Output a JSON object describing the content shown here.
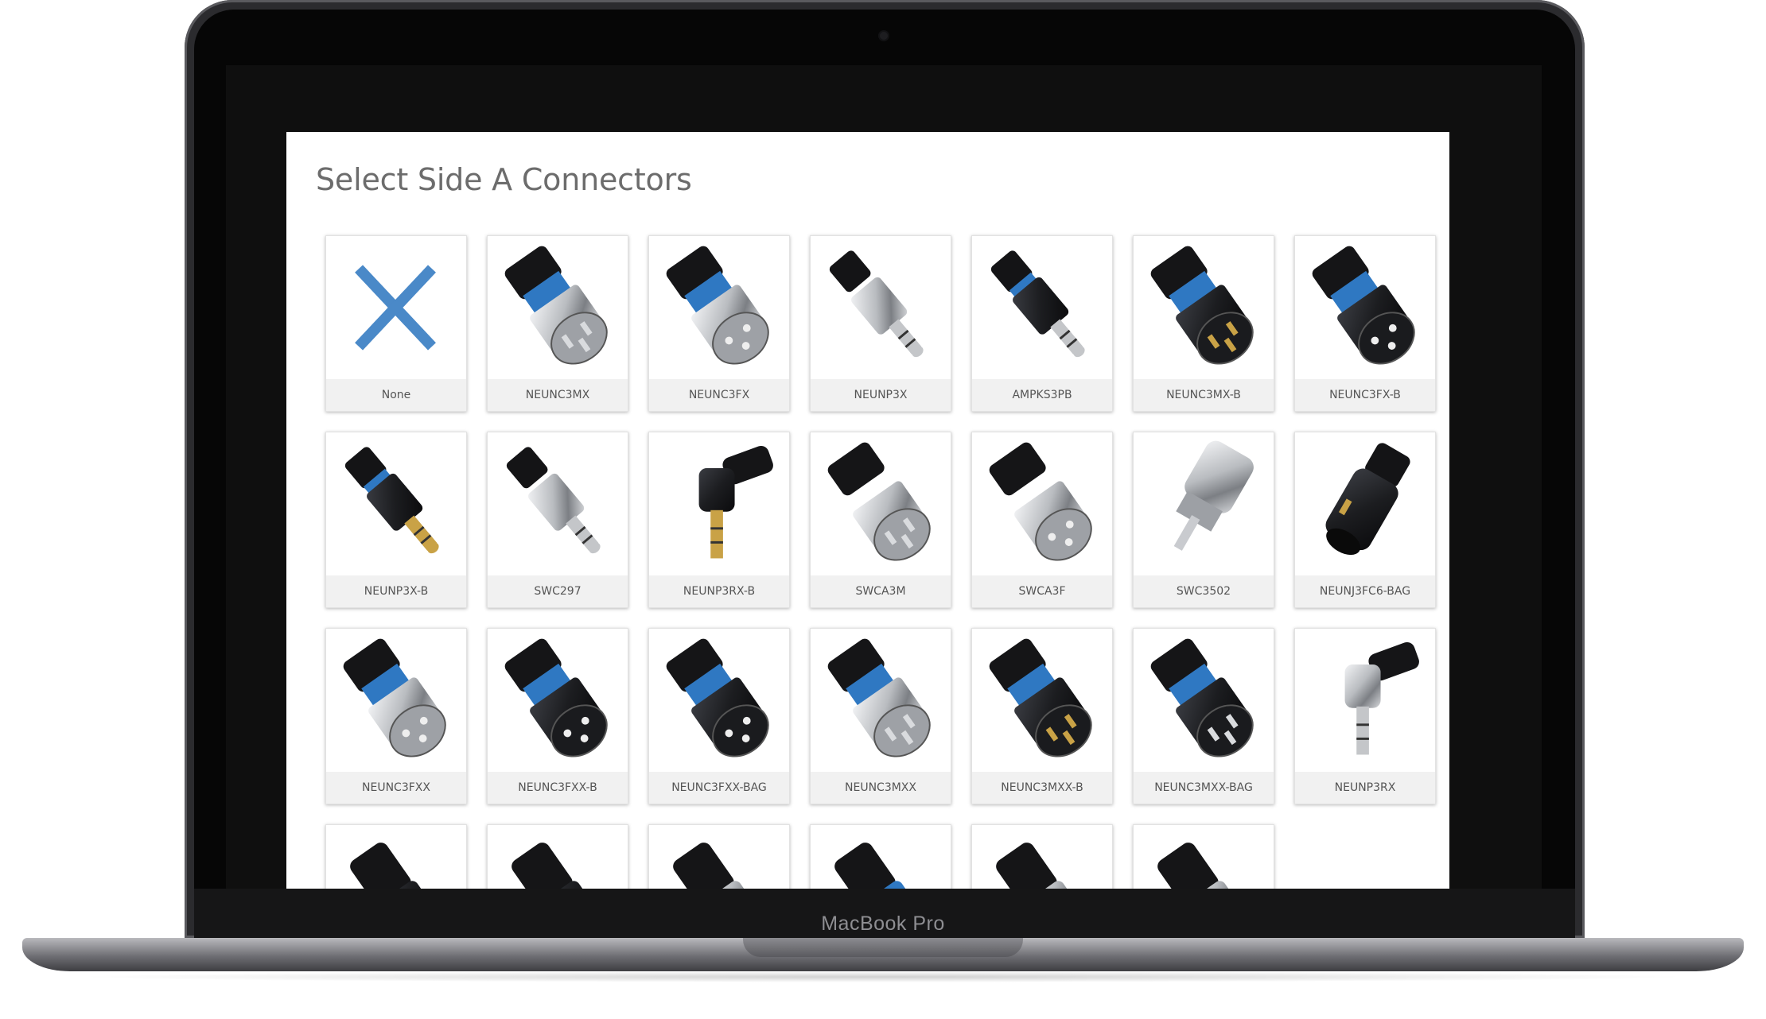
{
  "device": {
    "brand": "MacBook Pro"
  },
  "page": {
    "title": "Select Side A Connectors"
  },
  "connectors": [
    {
      "label": "None",
      "icon": "none-x-icon"
    },
    {
      "label": "NEUNC3MX",
      "icon": "xlr-male-chrome-icon"
    },
    {
      "label": "NEUNC3FX",
      "icon": "xlr-female-chrome-icon"
    },
    {
      "label": "NEUNP3X",
      "icon": "trs-plug-chrome-icon"
    },
    {
      "label": "AMPKS3PB",
      "icon": "mini-jack-black-icon"
    },
    {
      "label": "NEUNC3MX-B",
      "icon": "xlr-male-black-gold-icon"
    },
    {
      "label": "NEUNC3FX-B",
      "icon": "xlr-female-black-icon"
    },
    {
      "label": "NEUNP3X-B",
      "icon": "trs-plug-black-gold-icon"
    },
    {
      "label": "SWC297",
      "icon": "trs-plug-slim-icon"
    },
    {
      "label": "NEUNP3RX-B",
      "icon": "trs-right-angle-black-icon"
    },
    {
      "label": "SWCA3M",
      "icon": "xlr-male-metal-icon"
    },
    {
      "label": "SWCA3F",
      "icon": "xlr-female-metal-icon"
    },
    {
      "label": "SWC3502",
      "icon": "rca-plug-metal-icon"
    },
    {
      "label": "NEUNJ3FC6-BAG",
      "icon": "trs-jack-black-icon"
    },
    {
      "label": "NEUNC3FXX",
      "icon": "xlr-female-chrome-icon"
    },
    {
      "label": "NEUNC3FXX-B",
      "icon": "xlr-female-black-icon"
    },
    {
      "label": "NEUNC3FXX-BAG",
      "icon": "xlr-female-black-icon"
    },
    {
      "label": "NEUNC3MXX",
      "icon": "xlr-male-chrome-icon"
    },
    {
      "label": "NEUNC3MXX-B",
      "icon": "xlr-male-black-gold-icon"
    },
    {
      "label": "NEUNC3MXX-BAG",
      "icon": "xlr-male-black-icon"
    },
    {
      "label": "NEUNP3RX",
      "icon": "trs-right-angle-chrome-icon"
    },
    {
      "label": "",
      "icon": "connector-black-icon"
    },
    {
      "label": "",
      "icon": "connector-black-icon"
    },
    {
      "label": "",
      "icon": "connector-chrome-icon"
    },
    {
      "label": "",
      "icon": "connector-blue-icon"
    },
    {
      "label": "",
      "icon": "connector-chrome-icon"
    },
    {
      "label": "",
      "icon": "connector-right-angle-icon"
    }
  ],
  "colors": {
    "accent_blue": "#4a89c8",
    "connector_blue": "#2f78c2",
    "chrome": "#b9bcc0",
    "black_body": "#1c1d20",
    "gold_pin": "#c9a246"
  }
}
